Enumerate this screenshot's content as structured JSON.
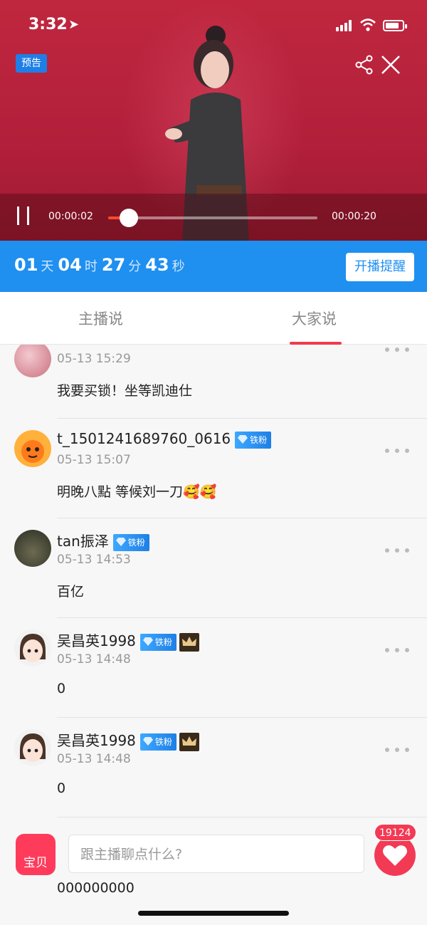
{
  "status_bar": {
    "time": "3:32",
    "location_arrow": "location-arrow-icon"
  },
  "video": {
    "badge": "预告",
    "current_time": "00:00:02",
    "total_time": "00:00:20",
    "progress_percent": 10
  },
  "countdown": {
    "days": "01",
    "days_unit": "天",
    "hours": "04",
    "hours_unit": "时",
    "minutes": "27",
    "minutes_unit": "分",
    "seconds": "43",
    "seconds_unit": "秒",
    "remind_label": "开播提醒"
  },
  "tabs": [
    {
      "label": "主播说",
      "active": false
    },
    {
      "label": "大家说",
      "active": true
    }
  ],
  "comments": [
    {
      "user": "",
      "time": "05-13 15:29",
      "text": "我要买锁！坐等凯迪仕",
      "badge": ""
    },
    {
      "user": "t_1501241689760_0616",
      "time": "05-13 15:07",
      "text": "明晚八點 等候刘一刀🥰🥰",
      "badge": "铁粉"
    },
    {
      "user": "tan振泽",
      "time": "05-13 14:53",
      "text": "百亿",
      "badge": "铁粉"
    },
    {
      "user": "吴昌英1998",
      "time": "05-13 14:48",
      "text": "0",
      "badge": "铁粉"
    },
    {
      "user": "吴昌英1998",
      "time": "05-13 14:48",
      "text": "0",
      "badge": "铁粉"
    },
    {
      "user": "",
      "time": "",
      "text": "000000000",
      "badge": ""
    }
  ],
  "bottom": {
    "bao_label": "宝贝",
    "chat_placeholder": "跟主播聊点什么?",
    "like_count": "19124"
  },
  "colors": {
    "accent_blue": "#1f8ff0",
    "accent_red": "#f23a4a",
    "video_bg": "#b21f3a"
  }
}
